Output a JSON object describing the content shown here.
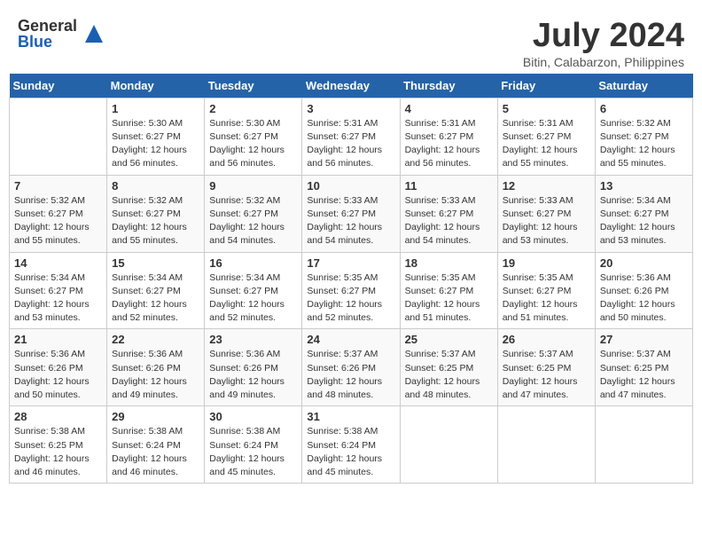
{
  "header": {
    "logo_general": "General",
    "logo_blue": "Blue",
    "month_year": "July 2024",
    "location": "Bitin, Calabarzon, Philippines"
  },
  "days_of_week": [
    "Sunday",
    "Monday",
    "Tuesday",
    "Wednesday",
    "Thursday",
    "Friday",
    "Saturday"
  ],
  "weeks": [
    [
      {
        "day": "",
        "sunrise": "",
        "sunset": "",
        "daylight": ""
      },
      {
        "day": "1",
        "sunrise": "Sunrise: 5:30 AM",
        "sunset": "Sunset: 6:27 PM",
        "daylight": "Daylight: 12 hours and 56 minutes."
      },
      {
        "day": "2",
        "sunrise": "Sunrise: 5:30 AM",
        "sunset": "Sunset: 6:27 PM",
        "daylight": "Daylight: 12 hours and 56 minutes."
      },
      {
        "day": "3",
        "sunrise": "Sunrise: 5:31 AM",
        "sunset": "Sunset: 6:27 PM",
        "daylight": "Daylight: 12 hours and 56 minutes."
      },
      {
        "day": "4",
        "sunrise": "Sunrise: 5:31 AM",
        "sunset": "Sunset: 6:27 PM",
        "daylight": "Daylight: 12 hours and 56 minutes."
      },
      {
        "day": "5",
        "sunrise": "Sunrise: 5:31 AM",
        "sunset": "Sunset: 6:27 PM",
        "daylight": "Daylight: 12 hours and 55 minutes."
      },
      {
        "day": "6",
        "sunrise": "Sunrise: 5:32 AM",
        "sunset": "Sunset: 6:27 PM",
        "daylight": "Daylight: 12 hours and 55 minutes."
      }
    ],
    [
      {
        "day": "7",
        "sunrise": "Sunrise: 5:32 AM",
        "sunset": "Sunset: 6:27 PM",
        "daylight": "Daylight: 12 hours and 55 minutes."
      },
      {
        "day": "8",
        "sunrise": "Sunrise: 5:32 AM",
        "sunset": "Sunset: 6:27 PM",
        "daylight": "Daylight: 12 hours and 55 minutes."
      },
      {
        "day": "9",
        "sunrise": "Sunrise: 5:32 AM",
        "sunset": "Sunset: 6:27 PM",
        "daylight": "Daylight: 12 hours and 54 minutes."
      },
      {
        "day": "10",
        "sunrise": "Sunrise: 5:33 AM",
        "sunset": "Sunset: 6:27 PM",
        "daylight": "Daylight: 12 hours and 54 minutes."
      },
      {
        "day": "11",
        "sunrise": "Sunrise: 5:33 AM",
        "sunset": "Sunset: 6:27 PM",
        "daylight": "Daylight: 12 hours and 54 minutes."
      },
      {
        "day": "12",
        "sunrise": "Sunrise: 5:33 AM",
        "sunset": "Sunset: 6:27 PM",
        "daylight": "Daylight: 12 hours and 53 minutes."
      },
      {
        "day": "13",
        "sunrise": "Sunrise: 5:34 AM",
        "sunset": "Sunset: 6:27 PM",
        "daylight": "Daylight: 12 hours and 53 minutes."
      }
    ],
    [
      {
        "day": "14",
        "sunrise": "Sunrise: 5:34 AM",
        "sunset": "Sunset: 6:27 PM",
        "daylight": "Daylight: 12 hours and 53 minutes."
      },
      {
        "day": "15",
        "sunrise": "Sunrise: 5:34 AM",
        "sunset": "Sunset: 6:27 PM",
        "daylight": "Daylight: 12 hours and 52 minutes."
      },
      {
        "day": "16",
        "sunrise": "Sunrise: 5:34 AM",
        "sunset": "Sunset: 6:27 PM",
        "daylight": "Daylight: 12 hours and 52 minutes."
      },
      {
        "day": "17",
        "sunrise": "Sunrise: 5:35 AM",
        "sunset": "Sunset: 6:27 PM",
        "daylight": "Daylight: 12 hours and 52 minutes."
      },
      {
        "day": "18",
        "sunrise": "Sunrise: 5:35 AM",
        "sunset": "Sunset: 6:27 PM",
        "daylight": "Daylight: 12 hours and 51 minutes."
      },
      {
        "day": "19",
        "sunrise": "Sunrise: 5:35 AM",
        "sunset": "Sunset: 6:27 PM",
        "daylight": "Daylight: 12 hours and 51 minutes."
      },
      {
        "day": "20",
        "sunrise": "Sunrise: 5:36 AM",
        "sunset": "Sunset: 6:26 PM",
        "daylight": "Daylight: 12 hours and 50 minutes."
      }
    ],
    [
      {
        "day": "21",
        "sunrise": "Sunrise: 5:36 AM",
        "sunset": "Sunset: 6:26 PM",
        "daylight": "Daylight: 12 hours and 50 minutes."
      },
      {
        "day": "22",
        "sunrise": "Sunrise: 5:36 AM",
        "sunset": "Sunset: 6:26 PM",
        "daylight": "Daylight: 12 hours and 49 minutes."
      },
      {
        "day": "23",
        "sunrise": "Sunrise: 5:36 AM",
        "sunset": "Sunset: 6:26 PM",
        "daylight": "Daylight: 12 hours and 49 minutes."
      },
      {
        "day": "24",
        "sunrise": "Sunrise: 5:37 AM",
        "sunset": "Sunset: 6:26 PM",
        "daylight": "Daylight: 12 hours and 48 minutes."
      },
      {
        "day": "25",
        "sunrise": "Sunrise: 5:37 AM",
        "sunset": "Sunset: 6:25 PM",
        "daylight": "Daylight: 12 hours and 48 minutes."
      },
      {
        "day": "26",
        "sunrise": "Sunrise: 5:37 AM",
        "sunset": "Sunset: 6:25 PM",
        "daylight": "Daylight: 12 hours and 47 minutes."
      },
      {
        "day": "27",
        "sunrise": "Sunrise: 5:37 AM",
        "sunset": "Sunset: 6:25 PM",
        "daylight": "Daylight: 12 hours and 47 minutes."
      }
    ],
    [
      {
        "day": "28",
        "sunrise": "Sunrise: 5:38 AM",
        "sunset": "Sunset: 6:25 PM",
        "daylight": "Daylight: 12 hours and 46 minutes."
      },
      {
        "day": "29",
        "sunrise": "Sunrise: 5:38 AM",
        "sunset": "Sunset: 6:24 PM",
        "daylight": "Daylight: 12 hours and 46 minutes."
      },
      {
        "day": "30",
        "sunrise": "Sunrise: 5:38 AM",
        "sunset": "Sunset: 6:24 PM",
        "daylight": "Daylight: 12 hours and 45 minutes."
      },
      {
        "day": "31",
        "sunrise": "Sunrise: 5:38 AM",
        "sunset": "Sunset: 6:24 PM",
        "daylight": "Daylight: 12 hours and 45 minutes."
      },
      {
        "day": "",
        "sunrise": "",
        "sunset": "",
        "daylight": ""
      },
      {
        "day": "",
        "sunrise": "",
        "sunset": "",
        "daylight": ""
      },
      {
        "day": "",
        "sunrise": "",
        "sunset": "",
        "daylight": ""
      }
    ]
  ]
}
